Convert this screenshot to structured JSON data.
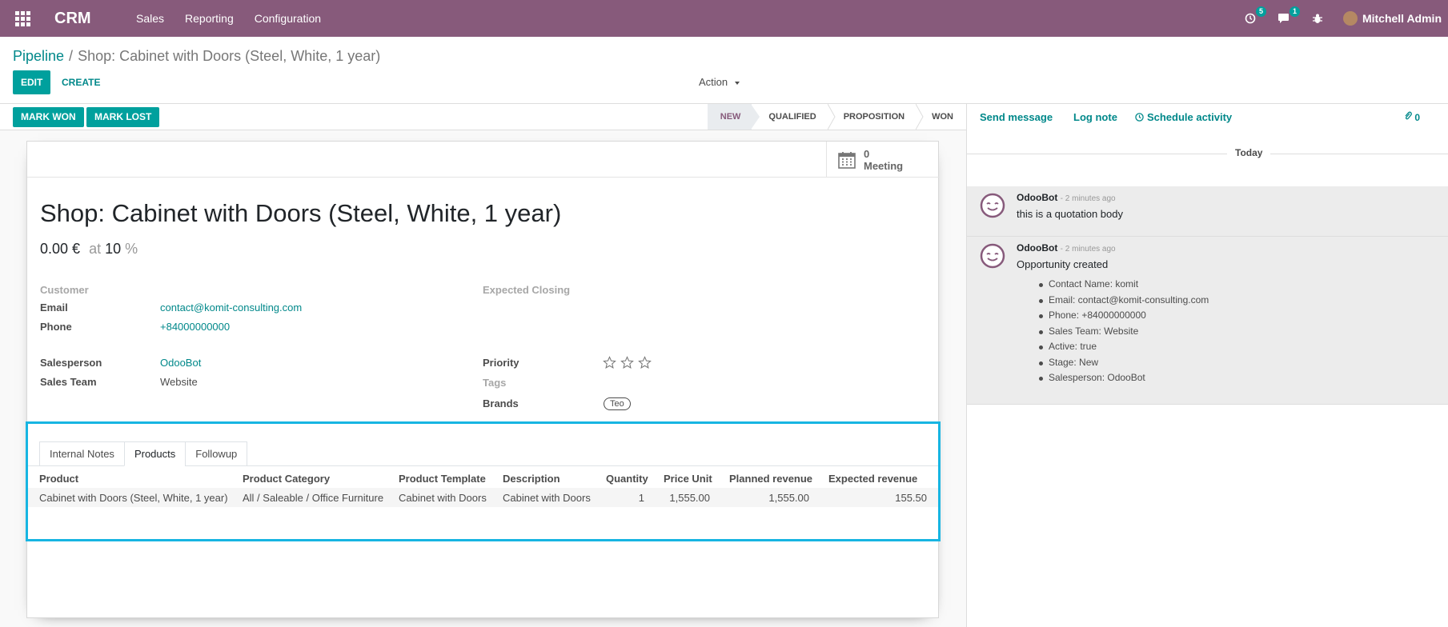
{
  "navbar": {
    "app_name": "CRM",
    "menu": [
      "Sales",
      "Reporting",
      "Configuration"
    ],
    "activity_count": "5",
    "message_count": "1",
    "user_name": "Mitchell Admin"
  },
  "control_panel": {
    "breadcrumb_parent": "Pipeline",
    "breadcrumb_separator": "/",
    "breadcrumb_current": "Shop: Cabinet with Doors (Steel, White, 1 year)",
    "edit_label": "EDIT",
    "create_label": "CREATE",
    "action_label": "Action"
  },
  "statusbar": {
    "mark_won": "MARK WON",
    "mark_lost": "MARK LOST",
    "stages": [
      "NEW",
      "QUALIFIED",
      "PROPOSITION",
      "WON"
    ],
    "active_stage": "NEW"
  },
  "form": {
    "meeting_count": "0",
    "meeting_label": "Meeting",
    "title": "Shop: Cabinet with Doors (Steel, White, 1 year)",
    "expected_revenue": "0.00 €",
    "at_label": "at",
    "probability": "10",
    "percent": "%",
    "customer_label": "Customer",
    "email_label": "Email",
    "email_value": "contact@komit-consulting.com",
    "phone_label": "Phone",
    "phone_value": "+84000000000",
    "expected_closing_label": "Expected Closing",
    "salesperson_label": "Salesperson",
    "salesperson_value": "OdooBot",
    "sales_team_label": "Sales Team",
    "sales_team_value": "Website",
    "priority_label": "Priority",
    "priority_stars": 0,
    "tags_label": "Tags",
    "brands_label": "Brands",
    "brand_tag": "Teo"
  },
  "notebook": {
    "tabs": [
      "Internal Notes",
      "Products",
      "Followup"
    ],
    "active_tab": "Products",
    "columns": [
      "Product",
      "Product Category",
      "Product Template",
      "Description",
      "Quantity",
      "Price Unit",
      "Planned revenue",
      "Expected revenue"
    ],
    "rows": [
      [
        "Cabinet with Doors (Steel, White, 1 year)",
        "All / Saleable / Office Furniture",
        "Cabinet with Doors",
        "Cabinet with Doors",
        "1",
        "1,555.00",
        "1,555.00",
        "155.50"
      ]
    ]
  },
  "chatter": {
    "send_message": "Send message",
    "log_note": "Log note",
    "schedule_activity": "Schedule activity",
    "followers_count": "0",
    "date_separator": "Today",
    "messages": [
      {
        "author": "OdooBot",
        "date": "- 2 minutes ago",
        "body": "this is a quotation body",
        "items": []
      },
      {
        "author": "OdooBot",
        "date": "- 2 minutes ago",
        "body": "Opportunity created",
        "items": [
          "Contact Name: komit",
          "Email: contact@komit-consulting.com",
          "Phone: +84000000000",
          "Sales Team: Website",
          "Active: true",
          "Stage: New",
          "Salesperson: OdooBot"
        ]
      }
    ]
  },
  "colors": {
    "navbar": "#875a7b",
    "primary": "#00a09d",
    "link": "#00888a",
    "highlight_border": "#17b5e2"
  }
}
